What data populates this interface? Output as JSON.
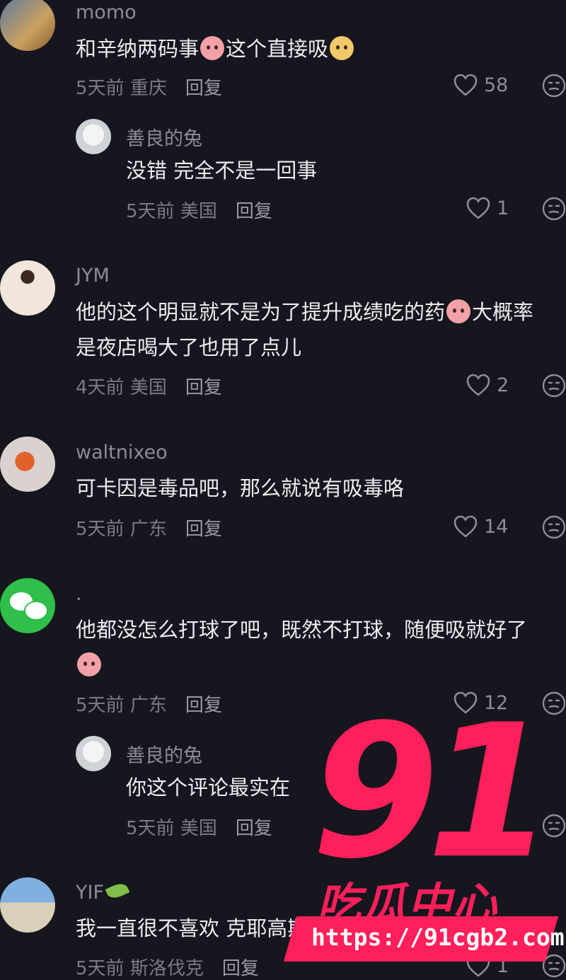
{
  "comments": [
    {
      "user": "momo",
      "text_pre": "和辛纳两码事",
      "text_mid": "这个直接吸",
      "time": "5天前",
      "location": "重庆",
      "reply_label": "回复",
      "likes": "58"
    },
    {
      "user": "善良的兔",
      "text": "没错 完全不是一回事",
      "time": "5天前",
      "location": "美国",
      "reply_label": "回复",
      "likes": "1"
    },
    {
      "user": "JYM",
      "text_line1_pre": "他的这个明显就不是为了提升成绩吃的药",
      "text_line1_post": "大概率",
      "text_line2": "是夜店喝大了也用了点儿",
      "time": "4天前",
      "location": "美国",
      "reply_label": "回复",
      "likes": "2"
    },
    {
      "user": "waltnixeo",
      "text": "可卡因是毒品吧，那么就说有吸毒咯",
      "time": "5天前",
      "location": "广东",
      "reply_label": "回复",
      "likes": "14"
    },
    {
      "user": ".",
      "text_line1": "他都没怎么打球了吧，既然不打球，随便吸就好了",
      "time": "5天前",
      "location": "广东",
      "reply_label": "回复",
      "likes": "12"
    },
    {
      "user": "善良的兔",
      "text": "你这个评论最实在",
      "time": "5天前",
      "location": "美国",
      "reply_label": "回复"
    },
    {
      "user": "YIF",
      "text": "我一直很不喜欢 克耶高斯",
      "time": "5天前",
      "location": "斯洛伐克",
      "reply_label": "回复",
      "likes": "1"
    }
  ],
  "watermark": {
    "number": "91",
    "subtitle": "吃瓜中心",
    "url": "https://91cgb2.com"
  },
  "colors": {
    "background": "#16161e",
    "watermark": "#ff1f5a"
  }
}
